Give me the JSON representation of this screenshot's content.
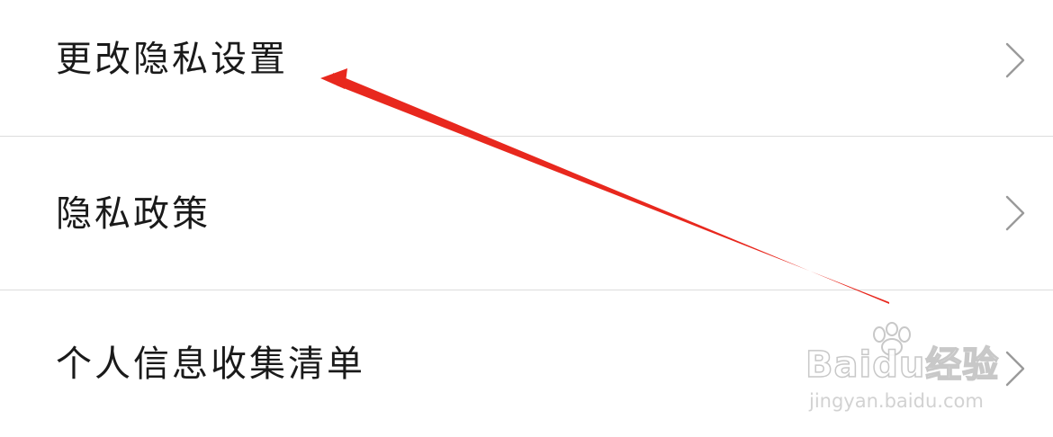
{
  "settings": {
    "items": [
      {
        "label": "更改隐私设置"
      },
      {
        "label": "隐私政策"
      },
      {
        "label": "个人信息收集清单"
      }
    ]
  },
  "annotation": {
    "color": "#e8281e"
  },
  "watermark": {
    "brand": "Baidu经验",
    "url": "jingyan.baidu.com"
  }
}
